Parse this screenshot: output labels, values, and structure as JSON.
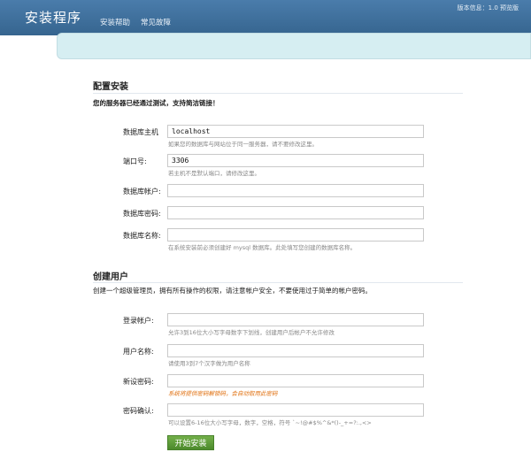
{
  "header": {
    "title": "安装程序",
    "nav": [
      "安装帮助",
      "常见故障"
    ],
    "version": "版本信息：1.0 预览版"
  },
  "config": {
    "title": "配置安装",
    "description": "您的服务器已经通过测试，支持简洁链接！",
    "fields": [
      {
        "label": "数据库主机",
        "value": "localhost",
        "hint": "如果您的数据库与网站位于同一服务器，请不要修改这里。"
      },
      {
        "label": "端口号:",
        "value": "3306",
        "hint": "若主机不是默认端口，请修改这里。"
      },
      {
        "label": "数据库帐户:",
        "value": "",
        "hint": ""
      },
      {
        "label": "数据库密码:",
        "value": "",
        "hint": ""
      },
      {
        "label": "数据库名称:",
        "value": "",
        "hint": "在系统安装前必须创建好 mysql 数据库。此处填写您创建的数据库名称。"
      }
    ]
  },
  "user": {
    "title": "创建用户",
    "description": "创建一个超级管理员，拥有所有操作的权限，请注意帐户安全，不要使用过于简单的帐户密码。",
    "fields": [
      {
        "label": "登录帐户:",
        "value": "",
        "hint": "允许3到16位大小写字母数字下划线，创建用户后帐户不允许修改"
      },
      {
        "label": "用户名称:",
        "value": "",
        "hint": "请使用3到7个汉字做为用户名称"
      },
      {
        "label": "新设密码:",
        "value": "",
        "hint": "系统将提供密码解锁码，会自动取用此密码"
      },
      {
        "label": "密码确认:",
        "value": "",
        "hint": "可以设置6-16位大小写字母，数字，空格，符号 `~!@#$%^&*()-_+=?:.,<>"
      }
    ]
  },
  "submit_label": "开始安装"
}
